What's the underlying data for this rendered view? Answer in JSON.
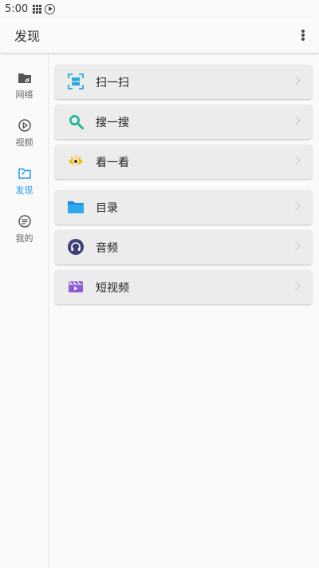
{
  "status_bar": {
    "time": "5:00"
  },
  "app_bar": {
    "title": "发现"
  },
  "sidebar": {
    "items": [
      {
        "label": "网络",
        "icon": "folder-wifi-icon",
        "active": false
      },
      {
        "label": "视频",
        "icon": "play-circle-icon",
        "active": false
      },
      {
        "label": "发现",
        "icon": "folder-explore-icon",
        "active": true
      },
      {
        "label": "我的",
        "icon": "list-circle-icon",
        "active": false
      }
    ]
  },
  "cards": [
    {
      "label": "扫一扫",
      "icon": "scan-icon"
    },
    {
      "label": "搜一搜",
      "icon": "search-icon"
    },
    {
      "label": "看一看",
      "icon": "eye-icon"
    },
    {
      "label": "目录",
      "icon": "folder-icon"
    },
    {
      "label": "音频",
      "icon": "headphones-icon"
    },
    {
      "label": "短视频",
      "icon": "clapperboard-icon"
    }
  ],
  "colors": {
    "active": "#2196f3",
    "scan": "#29a8e0",
    "search": "#26b59a",
    "eye": "#f5b400",
    "folder": "#2196f3",
    "audio": "#3f3f7a",
    "video": "#8e5cd6"
  }
}
